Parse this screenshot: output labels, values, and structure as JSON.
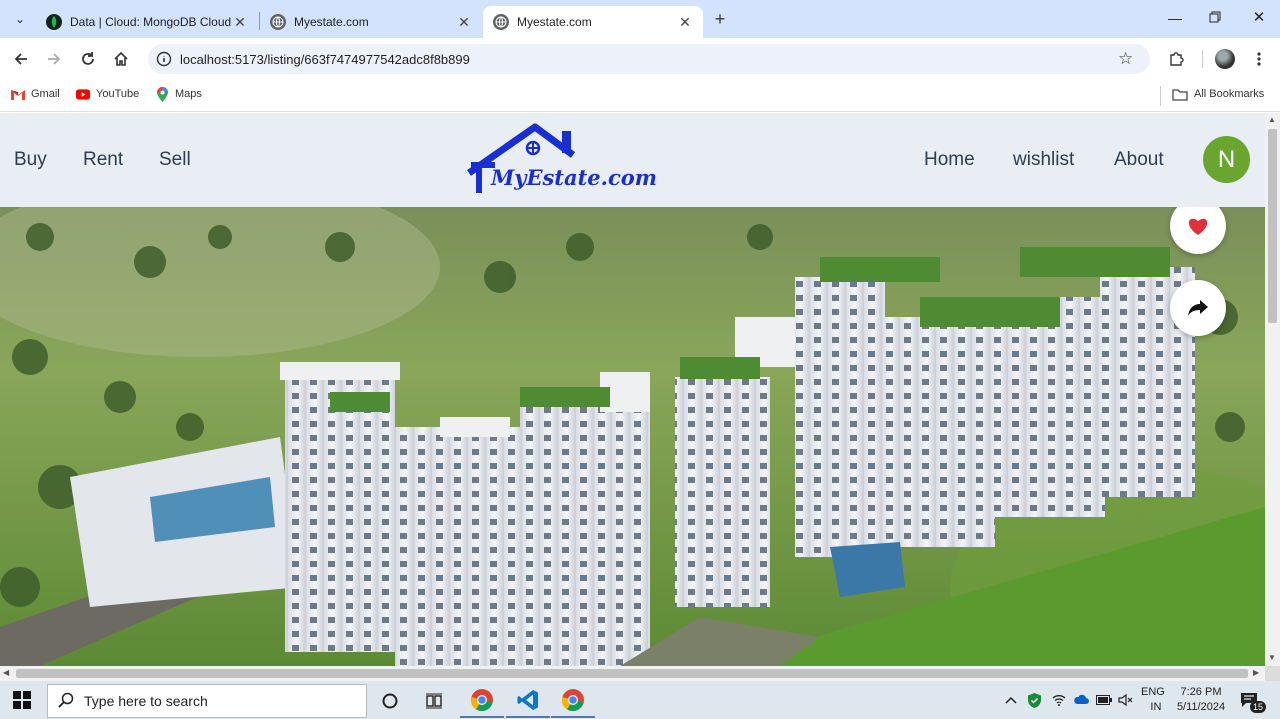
{
  "browser": {
    "tabs": [
      {
        "title": "Data | Cloud: MongoDB Cloud",
        "active": false,
        "icon": "mongodb-leaf-icon"
      },
      {
        "title": "Myestate.com",
        "active": false,
        "icon": "globe-icon"
      },
      {
        "title": "Myestate.com",
        "active": true,
        "icon": "globe-icon"
      }
    ],
    "url": "localhost:5173/listing/663f7474977542adc8f8b899",
    "bookmarks": [
      {
        "label": "Gmail",
        "icon": "gmail-icon"
      },
      {
        "label": "YouTube",
        "icon": "youtube-icon"
      },
      {
        "label": "Maps",
        "icon": "maps-icon"
      }
    ],
    "all_bookmarks": "All Bookmarks"
  },
  "site": {
    "left_nav": [
      "Buy",
      "Rent",
      "Sell"
    ],
    "right_nav": [
      "Home",
      "wishlist",
      "About"
    ],
    "logo_text": "MyEstate.com",
    "avatar_initial": "N",
    "brand_color": "#1a2fd1",
    "avatar_color": "#6aa52f",
    "heart_color": "#e0303a"
  },
  "taskbar": {
    "search_placeholder": "Type here to search",
    "lang_top": "ENG",
    "lang_bottom": "IN",
    "time": "7:26 PM",
    "date": "5/11/2024",
    "notification_count": "15"
  }
}
